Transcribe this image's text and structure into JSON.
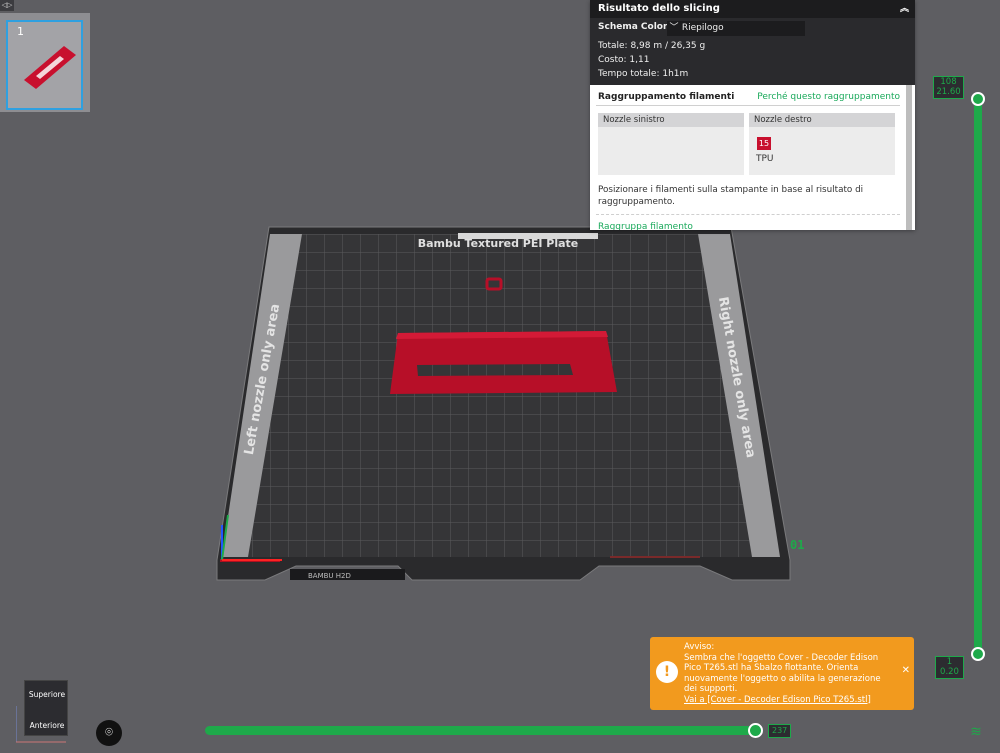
{
  "colors": {
    "accent": "#1ea94a",
    "warning": "#f29a1e",
    "filament": "#c8102e",
    "panel_dark": "#2a2a2d"
  },
  "plate": {
    "name": "Bambu Textured PEI Plate",
    "left_area": "Left nozzle only area",
    "right_area": "Right nozzle only area",
    "plate_number": "01",
    "front_label": "BAMBU H2D"
  },
  "thumbnail": {
    "index": "1"
  },
  "slicing": {
    "title": "Risultato dello slicing",
    "color_scheme_label": "Schema Colore",
    "color_scheme_value": "Riepilogo",
    "total": "Totale:   8,98 m / 26,35 g",
    "cost": "Costo:   1,11",
    "time": "Tempo totale:   1h1m",
    "grouping_title": "Raggruppamento filamenti",
    "grouping_link": "Perché questo raggruppamento",
    "left_nozzle": "Nozzle sinistro",
    "right_nozzle": "Nozzle destro",
    "filament_id": "15",
    "filament_type": "TPU",
    "description": "Posizionare i filamenti sulla stampante in base al risultato di raggruppamento.",
    "cut_link": "Raggruppa filamento"
  },
  "layer_slider": {
    "top_layer": "108",
    "top_height": "21.60",
    "bottom_layer": "1",
    "bottom_height": "0.20"
  },
  "move_slider": {
    "value": "237"
  },
  "warning": {
    "title": "Avviso:",
    "message": "Sembra che l'oggetto Cover - Decoder Edison Pico T265.stl ha Sbalzo flottante. Orienta nuovamente l'oggetto o abilita la generazione dei supporti.",
    "link": "Vai a [Cover - Decoder Edison Pico T265.stl]"
  },
  "view_cube": {
    "top": "Superiore",
    "front": "Anteriore"
  },
  "icons": [
    "collapse-icon",
    "chevron-up-icon",
    "chevron-down-icon",
    "warning-icon",
    "close-icon",
    "camera-fit-icon",
    "layers-icon"
  ]
}
